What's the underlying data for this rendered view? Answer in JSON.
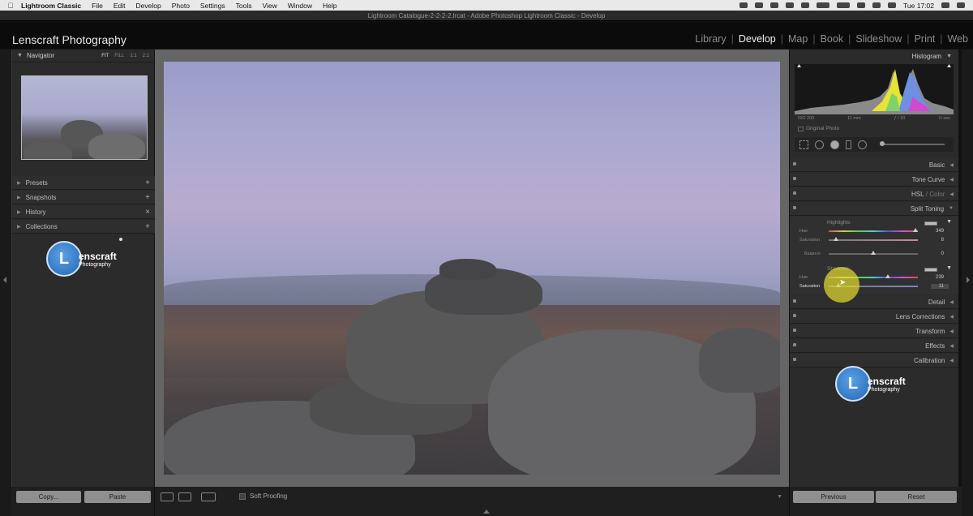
{
  "menubar": {
    "app_name": "Lightroom Classic",
    "items": [
      "File",
      "Edit",
      "Develop",
      "Photo",
      "Settings",
      "Tools",
      "View",
      "Window",
      "Help"
    ],
    "clock": "Tue 17:02"
  },
  "window_title": "Lightroom Catalogue-2-2-2-2.lrcat - Adobe Photoshop Lightroom Classic - Develop",
  "identity_plate": "Lenscraft Photography",
  "modules": [
    "Library",
    "Develop",
    "Map",
    "Book",
    "Slideshow",
    "Print",
    "Web"
  ],
  "active_module": "Develop",
  "navigator": {
    "title": "Navigator",
    "zoom_options": [
      "FIT",
      "FILL",
      "1:1",
      "2:1"
    ]
  },
  "left_sections": [
    {
      "label": "Presets",
      "action": "+"
    },
    {
      "label": "Snapshots",
      "action": "+"
    },
    {
      "label": "History",
      "action": "×"
    },
    {
      "label": "Collections",
      "action": "+"
    }
  ],
  "brand": {
    "initial": "L",
    "name": "enscraft",
    "sub": "Photography"
  },
  "left_buttons": {
    "copy": "Copy...",
    "paste": "Paste"
  },
  "toolbar": {
    "soft_proofing": "Soft Proofing"
  },
  "histogram": {
    "title": "Histogram",
    "iso": "ISO 200",
    "focal": "11 mm",
    "aperture": "ƒ / 10",
    "shutter": "½ sec",
    "original_photo": "Original Photo"
  },
  "right_sections_top": [
    {
      "label": "Basic"
    },
    {
      "label": "Tone Curve"
    },
    {
      "label": "HSL",
      "label2": "Color"
    },
    {
      "label": "Split Toning"
    }
  ],
  "split_toning": {
    "highlights_label": "Highlights",
    "shadows_label": "Shadows",
    "highlights": {
      "hue_label": "Hue",
      "hue": "349",
      "hue_pct": 0.97,
      "sat_label": "Saturation",
      "sat": "8",
      "sat_pct": 0.08
    },
    "balance": {
      "label": "Balance",
      "value": "0",
      "pct": 0.5
    },
    "shadows": {
      "hue_label": "Hue",
      "hue": "239",
      "hue_pct": 0.66,
      "sat_label": "Saturation",
      "sat": "11",
      "sat_pct": 0.11
    }
  },
  "right_sections_bottom": [
    {
      "label": "Detail"
    },
    {
      "label": "Lens Corrections"
    },
    {
      "label": "Transform"
    },
    {
      "label": "Effects"
    },
    {
      "label": "Calibration"
    }
  ],
  "right_buttons": {
    "previous": "Previous",
    "reset": "Reset"
  }
}
